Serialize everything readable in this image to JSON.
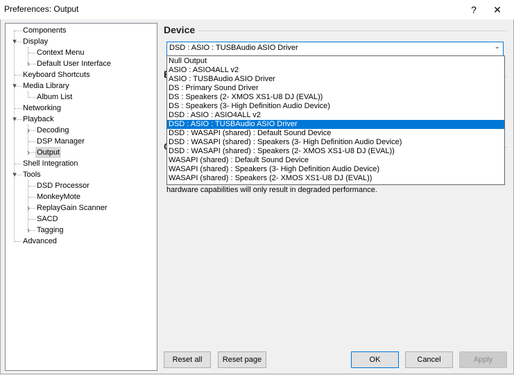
{
  "window": {
    "title": "Preferences: Output",
    "help": "?",
    "close": "✕"
  },
  "tree": {
    "items": [
      {
        "label": "Components",
        "level": 0,
        "expander": ""
      },
      {
        "label": "Display",
        "level": 0,
        "expander": "v"
      },
      {
        "label": "Context Menu",
        "level": 1,
        "expander": ""
      },
      {
        "label": "Default User Interface",
        "level": 1,
        "expander": ">"
      },
      {
        "label": "Keyboard Shortcuts",
        "level": 0,
        "expander": ""
      },
      {
        "label": "Media Library",
        "level": 0,
        "expander": "v"
      },
      {
        "label": "Album List",
        "level": 1,
        "expander": ""
      },
      {
        "label": "Networking",
        "level": 0,
        "expander": ""
      },
      {
        "label": "Playback",
        "level": 0,
        "expander": "v"
      },
      {
        "label": "Decoding",
        "level": 1,
        "expander": ">"
      },
      {
        "label": "DSP Manager",
        "level": 1,
        "expander": ""
      },
      {
        "label": "Output",
        "level": 1,
        "expander": ">",
        "selected": true
      },
      {
        "label": "Shell Integration",
        "level": 0,
        "expander": ""
      },
      {
        "label": "Tools",
        "level": 0,
        "expander": "v"
      },
      {
        "label": "DSD Processor",
        "level": 1,
        "expander": ""
      },
      {
        "label": "MonkeyMote",
        "level": 1,
        "expander": ""
      },
      {
        "label": "ReplayGain Scanner",
        "level": 1,
        "expander": ">"
      },
      {
        "label": "SACD",
        "level": 1,
        "expander": ""
      },
      {
        "label": "Tagging",
        "level": 1,
        "expander": ">"
      },
      {
        "label": "Advanced",
        "level": 0,
        "expander": ""
      }
    ]
  },
  "device": {
    "section_title": "Device",
    "selected": "DSD : ASIO : TUSBAudio ASIO Driver",
    "arrow": "⌄",
    "options": [
      "Null Output",
      "ASIO : ASIO4ALL v2",
      "ASIO : TUSBAudio ASIO Driver",
      "DS : Primary Sound Driver",
      "DS : Speakers (2- XMOS XS1-U8 DJ (EVAL))",
      "DS : Speakers (3- High Definition Audio Device)",
      "DSD : ASIO : ASIO4ALL v2",
      "DSD : ASIO : TUSBAudio ASIO Driver",
      "DSD : WASAPI (shared) : Default Sound Device",
      "DSD : WASAPI (shared) : Speakers (3- High Definition Audio Device)",
      "DSD : WASAPI (shared) : Speakers (2- XMOS XS1-U8 DJ (EVAL))",
      "WASAPI (shared) : Default Sound Device",
      "WASAPI (shared) : Speakers (3- High Definition Audio Device)",
      "WASAPI (shared) : Speakers (2- XMOS XS1-U8 DJ (EVAL))"
    ],
    "highlighted_index": 7
  },
  "partial": {
    "letter_b": "B",
    "letter_o": "O",
    "line2": "hardware capabilities will only result in degraded performance."
  },
  "buttons": {
    "reset_all": "Reset all",
    "reset_page": "Reset page",
    "ok": "OK",
    "cancel": "Cancel",
    "apply": "Apply"
  }
}
